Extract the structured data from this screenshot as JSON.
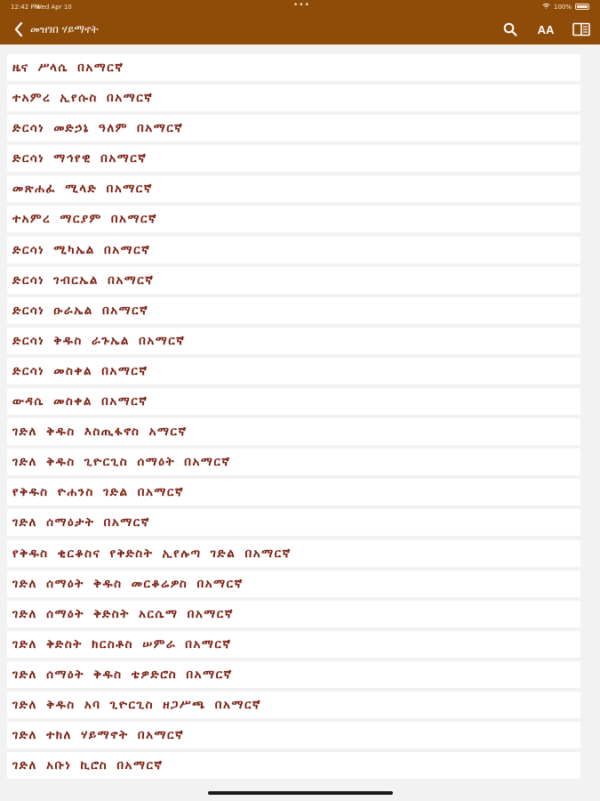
{
  "status": {
    "time": "12:42 PM",
    "date": "Wed Apr 10",
    "battery": "100%"
  },
  "nav": {
    "title": "መዝገበ ሃይማኖት",
    "icons": {
      "back": "chevron-left-icon",
      "search": "search-icon",
      "font_size": "font-size-icon",
      "book": "book-icon"
    },
    "font_size_label": "AA"
  },
  "colors": {
    "header": "#8f4b08",
    "item_text": "#7a1d10",
    "background": "#f2f2f2",
    "row_background": "#ffffff"
  },
  "items": [
    "ዜና ሥላሴ በአማርኛ",
    "ተአምረ ኢየሱስ በአማርኛ",
    "ድርሳነ መድኃኔ ዓለም በአማርኛ",
    "ድርሳነ ማኅየዊ በአማርኛ",
    "መጽሐፈ ሚላድ በአማርኛ",
    "ተአምረ ማርያም በአማርኛ",
    "ድርሳነ ሚካኤል በአማርኛ",
    "ድርሳነ ገብርኤል በአማርኛ",
    "ድርሳነ ዑራኤል በአማርኛ",
    "ድርሳነ ቅዱስ ራጉኤል በአማርኛ",
    "ድርሳነ መስቀል በአማርኛ",
    "ውዳሴ መስቀል በአማርኛ",
    "ገድለ ቅዱስ እስጢፋኖስ አማርኛ",
    "ገድለ ቅዱስ ጊዮርጊስ ሰማዕት በአማርኛ",
    "የቅዱስ ዮሐንስ ገድል በአማርኛ",
    "ገድለ ሰማዕታት በአማርኛ",
    "የቅዱስ ቂርቆስና የቅድስት ኢየሉጣ ገድል በአማርኛ",
    "ገድለ ሰማዕት ቅዱስ መርቆሬዎስ በአማርኛ",
    "ገድለ ሰማዕት ቅድስት አርሴማ በአማርኛ",
    "ገድለ ቅድስት ክርስቶስ ሠምራ በአማርኛ",
    "ገድለ ሰማዕት ቅዱስ ቴዎድሮስ በአማርኛ",
    "ገድለ ቅዱስ አባ ጊዮርጊስ ዘጋሥጫ በአማርኛ",
    "ገድለ ተክለ ሃይማኖት በአማርኛ",
    "ገድለ አቡነ ኪሮስ በአማርኛ"
  ]
}
